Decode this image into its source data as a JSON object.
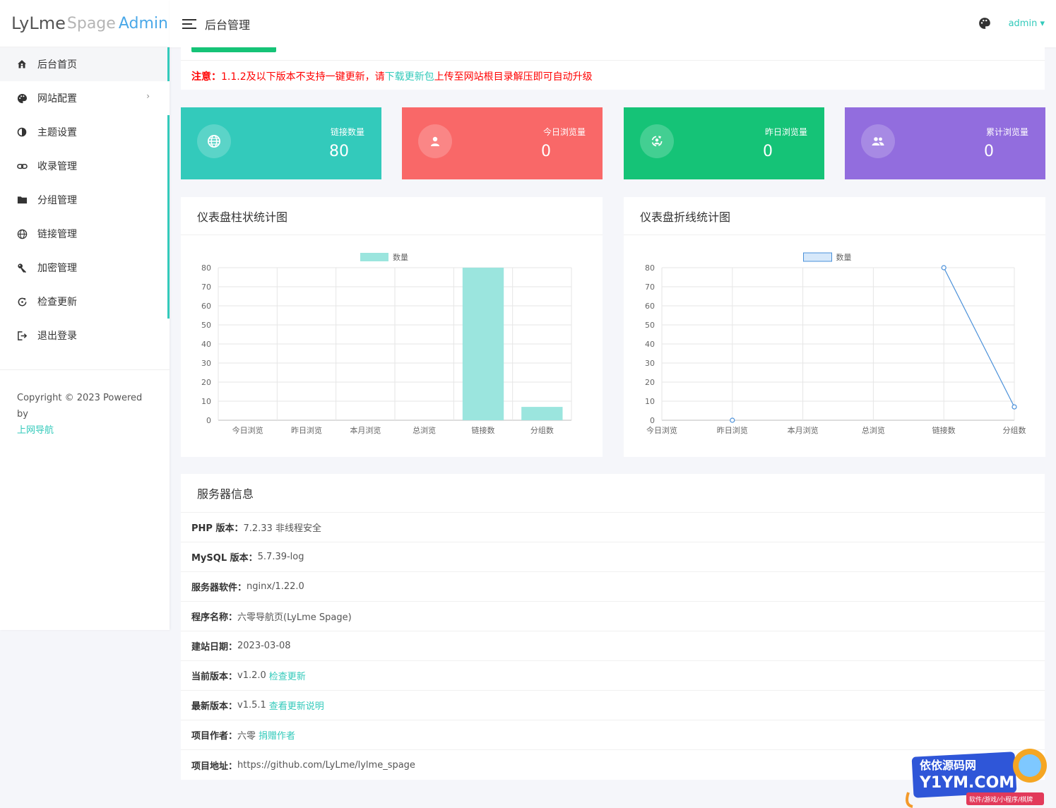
{
  "brand": {
    "part1": "LyLme",
    "part2": "Spage",
    "part3": "Admin"
  },
  "sidebar": {
    "items": [
      {
        "label": "后台首页",
        "icon": "home-icon",
        "active": true
      },
      {
        "label": "网站配置",
        "icon": "palette-icon",
        "has_submenu": true
      },
      {
        "label": "主题设置",
        "icon": "contrast-icon"
      },
      {
        "label": "收录管理",
        "icon": "link-icon"
      },
      {
        "label": "分组管理",
        "icon": "folder-icon"
      },
      {
        "label": "链接管理",
        "icon": "globe-icon"
      },
      {
        "label": "加密管理",
        "icon": "key-icon"
      },
      {
        "label": "检查更新",
        "icon": "refresh-icon"
      },
      {
        "label": "退出登录",
        "icon": "logout-icon"
      }
    ],
    "copyright": "Copyright © 2023 Powered by",
    "copyright_link": "上网导航"
  },
  "header": {
    "title": "后台管理",
    "user": "admin"
  },
  "notice": {
    "prefix": "注意：",
    "text1": "1.1.2及以下版本不支持一键更新，请",
    "link": "下载更新包",
    "text2": "上传至网站根目录解压即可自动升级"
  },
  "stats": [
    {
      "label": "链接数量",
      "value": "80",
      "color": "#33cabb",
      "icon": "globe-icon"
    },
    {
      "label": "今日浏览量",
      "value": "0",
      "color": "#f96868",
      "icon": "user-icon"
    },
    {
      "label": "昨日浏览量",
      "value": "0",
      "color": "#15c377",
      "icon": "refresh-user-icon"
    },
    {
      "label": "累计浏览量",
      "value": "0",
      "color": "#926dde",
      "icon": "users-icon"
    }
  ],
  "bar_card": {
    "title": "仪表盘柱状统计图"
  },
  "line_card": {
    "title": "仪表盘折线统计图"
  },
  "chart_data": [
    {
      "type": "bar",
      "title": "仪表盘柱状统计图",
      "categories": [
        "今日浏览",
        "昨日浏览",
        "本月浏览",
        "总浏览",
        "链接数",
        "分组数"
      ],
      "series": [
        {
          "name": "数量",
          "values": [
            0,
            0,
            0,
            0,
            80,
            7
          ]
        }
      ],
      "ylim": [
        0,
        80
      ],
      "yticks": [
        0,
        10,
        20,
        30,
        40,
        50,
        60,
        70,
        80
      ],
      "grid": true,
      "legend": "top-center",
      "color": "#9be5de"
    },
    {
      "type": "line",
      "title": "仪表盘折线统计图",
      "categories": [
        "今日浏览",
        "昨日浏览",
        "本月浏览",
        "总浏览",
        "链接数",
        "分组数"
      ],
      "series": [
        {
          "name": "数量",
          "values": [
            null,
            0,
            null,
            null,
            80,
            7
          ]
        }
      ],
      "ylim": [
        0,
        80
      ],
      "yticks": [
        0,
        10,
        20,
        30,
        40,
        50,
        60,
        70,
        80
      ],
      "grid": true,
      "legend": "top-center",
      "color": "#4a90d9"
    }
  ],
  "server": {
    "title": "服务器信息",
    "rows": [
      {
        "key": "PHP 版本：",
        "value": "7.2.33 非线程安全",
        "link": ""
      },
      {
        "key": "MySQL 版本：",
        "value": "5.7.39-log",
        "link": ""
      },
      {
        "key": "服务器软件：",
        "value": "nginx/1.22.0",
        "link": ""
      },
      {
        "key": "程序名称：",
        "value": "六零导航页(LyLme Spage)",
        "link": ""
      },
      {
        "key": "建站日期：",
        "value": "2023-03-08",
        "link": ""
      },
      {
        "key": "当前版本：",
        "value": "v1.2.0",
        "link": "检查更新"
      },
      {
        "key": "最新版本：",
        "value": " v1.5.1",
        "link": "查看更新说明"
      },
      {
        "key": "项目作者：",
        "value": "六零",
        "link": "捐赠作者"
      },
      {
        "key": "项目地址：",
        "value": "https://github.com/LyLme/lylme_spage",
        "link": ""
      }
    ]
  },
  "watermark": {
    "line1": "依依源码网",
    "line2": "Y1YM.COM",
    "line3": "软件/游戏/小程序/棋牌"
  }
}
